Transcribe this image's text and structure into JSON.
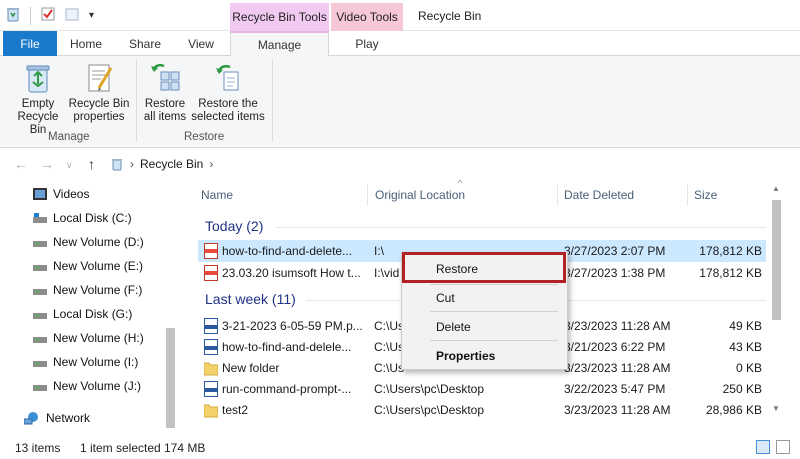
{
  "window": {
    "title": "Recycle Bin",
    "context_tab_groups": [
      "Recycle Bin Tools",
      "Video Tools"
    ]
  },
  "tabs": {
    "file": "File",
    "home": "Home",
    "share": "Share",
    "view": "View",
    "manage": "Manage",
    "play": "Play"
  },
  "ribbon": {
    "manage_group": {
      "label": "Manage",
      "empty_line1": "Empty",
      "empty_line2": "Recycle Bin",
      "props_line1": "Recycle Bin",
      "props_line2": "properties"
    },
    "restore_group": {
      "label": "Restore",
      "restore_all_line1": "Restore",
      "restore_all_line2": "all items",
      "restore_sel_line1": "Restore the",
      "restore_sel_line2": "selected items"
    }
  },
  "address": {
    "path": "Recycle Bin"
  },
  "nav_pane": {
    "items": [
      "Videos",
      "Local Disk (C:)",
      "New Volume (D:)",
      "New Volume (E:)",
      "New Volume (F:)",
      "Local Disk (G:)",
      "New Volume (H:)",
      "New Volume (I:)",
      "New Volume (J:)",
      "Network"
    ]
  },
  "columns": {
    "name": "Name",
    "original_location": "Original Location",
    "date_deleted": "Date Deleted",
    "size": "Size"
  },
  "groups": {
    "today": "Today (2)",
    "last_week": "Last week (11)"
  },
  "rows": [
    {
      "name": "how-to-find-and-delete...",
      "loc": "I:\\",
      "date": "3/27/2023 2:07 PM",
      "size": "178,812 KB"
    },
    {
      "name": "23.03.20 isumsoft How t...",
      "loc": "I:\\vid",
      "date": "3/27/2023 1:38 PM",
      "size": "178,812 KB"
    },
    {
      "name": "3-21-2023 6-05-59 PM.p...",
      "loc": "C:\\Us",
      "date": "3/23/2023 11:28 AM",
      "size": "49 KB"
    },
    {
      "name": "how-to-find-and-delele...",
      "loc": "C:\\Us",
      "date": "3/21/2023 6:22 PM",
      "size": "43 KB"
    },
    {
      "name": "New folder",
      "loc": "C:\\Us",
      "date": "3/23/2023 11:28 AM",
      "size": "0 KB"
    },
    {
      "name": "run-command-prompt-...",
      "loc": "C:\\Users\\pc\\Desktop",
      "date": "3/22/2023 5:47 PM",
      "size": "250 KB"
    },
    {
      "name": "test2",
      "loc": "C:\\Users\\pc\\Desktop",
      "date": "3/23/2023 11:28 AM",
      "size": "28,986 KB"
    }
  ],
  "context_menu": {
    "restore": "Restore",
    "cut": "Cut",
    "delete": "Delete",
    "properties": "Properties"
  },
  "status": {
    "count": "13 items",
    "selection": "1 item selected",
    "size": "174 MB"
  },
  "colors": {
    "file_tab": "#1979ca",
    "recycle_tools": "#f1c9f1",
    "video_tools": "#f6c8d7",
    "selection": "#cce8ff",
    "group_header": "#1e3287",
    "highlight_box": "#b22222"
  }
}
